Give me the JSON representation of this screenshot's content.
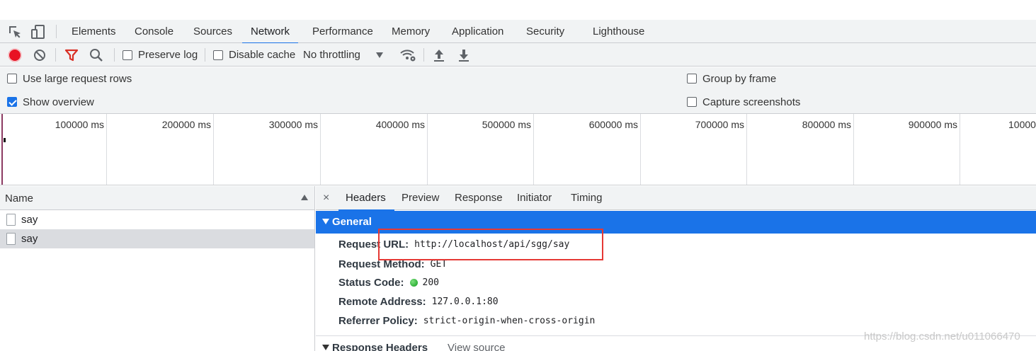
{
  "tabs": [
    "Elements",
    "Console",
    "Sources",
    "Network",
    "Performance",
    "Memory",
    "Application",
    "Security",
    "Lighthouse"
  ],
  "active_tab": "Network",
  "toolbar": {
    "preserve_log": "Preserve log",
    "disable_cache": "Disable cache",
    "throttling": "No throttling"
  },
  "settings": {
    "large_rows": "Use large request rows",
    "show_overview": "Show overview",
    "group_by_frame": "Group by frame",
    "capture_screenshots": "Capture screenshots"
  },
  "overview": {
    "ticks": [
      "100000 ms",
      "200000 ms",
      "300000 ms",
      "400000 ms",
      "500000 ms",
      "600000 ms",
      "700000 ms",
      "800000 ms",
      "900000 ms",
      "10000"
    ]
  },
  "requests": {
    "column_name": "Name",
    "rows": [
      "say",
      "say"
    ]
  },
  "details": {
    "close": "×",
    "tabs": [
      "Headers",
      "Preview",
      "Response",
      "Initiator",
      "Timing"
    ],
    "active_tab": "Headers",
    "general_title": "General",
    "general": [
      {
        "key": "Request URL:",
        "value": "http://localhost/api/sgg/say"
      },
      {
        "key": "Request Method:",
        "value": "GET"
      },
      {
        "key": "Status Code:",
        "value": "200"
      },
      {
        "key": "Remote Address:",
        "value": "127.0.0.1:80"
      },
      {
        "key": "Referrer Policy:",
        "value": "strict-origin-when-cross-origin"
      }
    ],
    "response_headers_title": "Response Headers",
    "view_source": "View source"
  },
  "colors": {
    "accent": "#1a73e8",
    "record": "#e81123",
    "filter": "#d93025",
    "highlight_box": "#e53935",
    "status_ok": "#0f9d1c"
  },
  "watermark": "https://blog.csdn.net/u011066470"
}
